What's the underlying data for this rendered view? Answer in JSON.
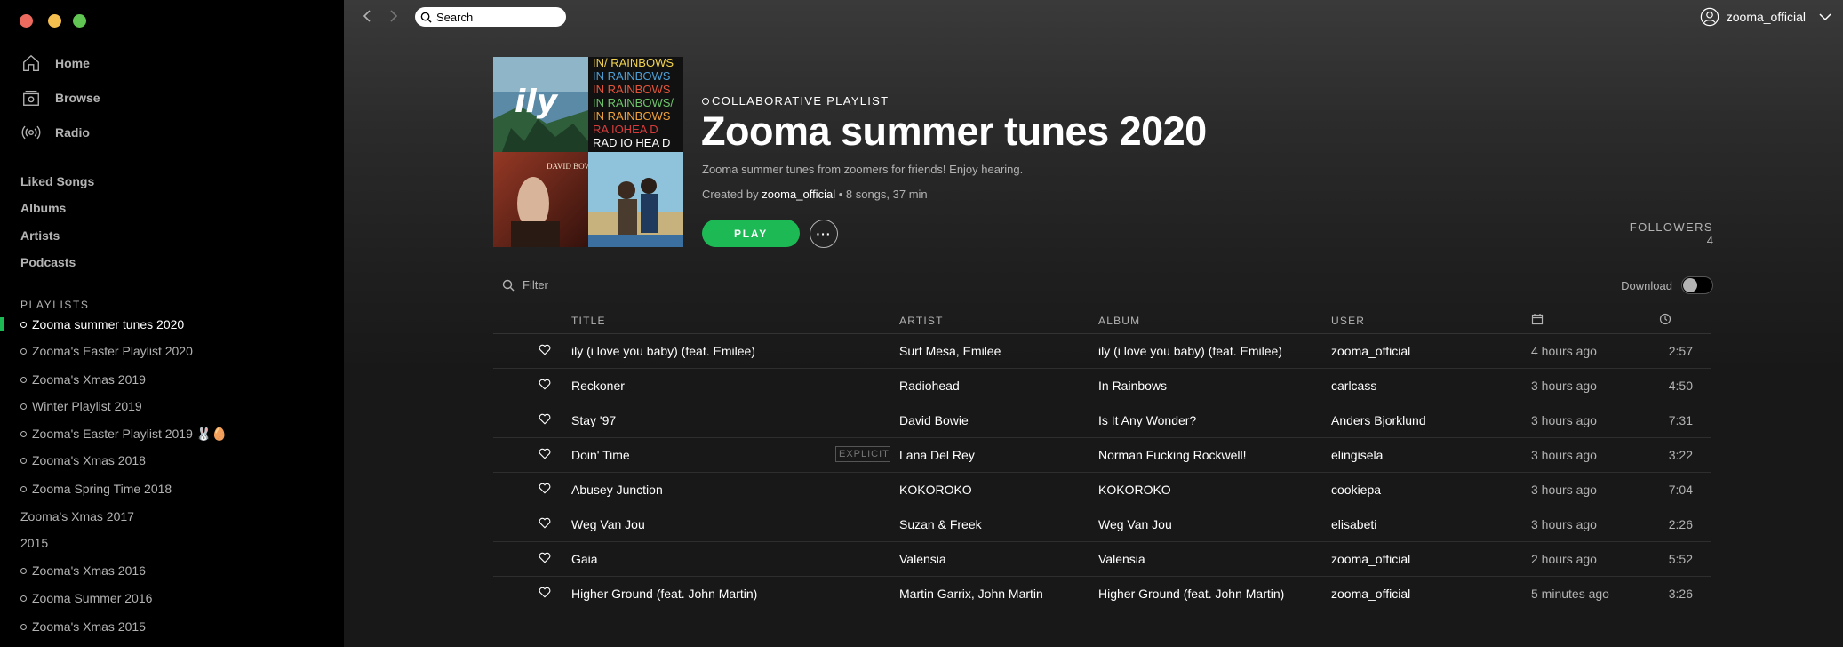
{
  "window": {
    "traffic_lights": [
      "#ed6a5e",
      "#f5bf4f",
      "#61c554"
    ]
  },
  "sidebar": {
    "nav": [
      {
        "label": "Home",
        "icon": "home-icon"
      },
      {
        "label": "Browse",
        "icon": "browse-icon"
      },
      {
        "label": "Radio",
        "icon": "radio-icon"
      }
    ],
    "library": [
      "Liked Songs",
      "Albums",
      "Artists",
      "Podcasts"
    ],
    "playlists_header": "PLAYLISTS",
    "playlists": [
      {
        "label": "Zooma summer tunes 2020",
        "collaborative": true,
        "active": true
      },
      {
        "label": "Zooma's Easter Playlist 2020",
        "collaborative": true
      },
      {
        "label": "Zooma's Xmas 2019",
        "collaborative": true
      },
      {
        "label": "Winter Playlist 2019",
        "collaborative": true
      },
      {
        "label": "Zooma's Easter Playlist 2019 🐰🥚",
        "collaborative": true
      },
      {
        "label": "Zooma's Xmas 2018",
        "collaborative": true
      },
      {
        "label": "Zooma Spring Time 2018",
        "collaborative": true
      },
      {
        "label": "Zooma's Xmas 2017",
        "collaborative": false
      },
      {
        "label": "2015",
        "collaborative": false
      },
      {
        "label": "Zooma's Xmas 2016",
        "collaborative": true
      },
      {
        "label": "Zooma Summer 2016",
        "collaborative": true
      },
      {
        "label": "Zooma's Xmas 2015",
        "collaborative": true
      }
    ]
  },
  "topbar": {
    "search_placeholder": "Search",
    "username": "zooma_official"
  },
  "playlist": {
    "tag": "COLLABORATIVE PLAYLIST",
    "title": "Zooma summer tunes 2020",
    "description": "Zooma summer tunes from zoomers for friends! Enjoy hearing.",
    "created_by_prefix": "Created by",
    "owner": "zooma_official",
    "stats": " • 8 songs, 37 min",
    "play_label": "PLAY",
    "more_label": "···",
    "followers_label": "FOLLOWERS",
    "followers_count": "4",
    "cover_text": {
      "ily": "ily",
      "rainbows_lines": [
        "IN/ RAINBOWS",
        "IN RAINBOWS",
        "IN RAINBOWS",
        "IN RAINBOWS/",
        "IN RAINBOWS",
        "RA IOHEA D",
        "RAD IO HEA D"
      ],
      "bowie": "DAVID BOWIE"
    }
  },
  "filter": {
    "placeholder": "Filter"
  },
  "download": {
    "label": "Download",
    "enabled": false
  },
  "table": {
    "headers": {
      "title": "TITLE",
      "artist": "ARTIST",
      "album": "ALBUM",
      "user": "USER"
    },
    "explicit_label": "EXPLICIT",
    "rows": [
      {
        "title": "ily (i love you baby) (feat. Emilee)",
        "artist": "Surf Mesa, Emilee",
        "album": "ily (i love you baby) (feat. Emilee)",
        "user": "zooma_official",
        "added": "4 hours ago",
        "duration": "2:57"
      },
      {
        "title": "Reckoner",
        "artist": "Radiohead",
        "album": "In Rainbows",
        "user": "carlcass",
        "added": "3 hours ago",
        "duration": "4:50"
      },
      {
        "title": "Stay '97",
        "artist": "David Bowie",
        "album": "Is It Any Wonder?",
        "user": "Anders Bjorklund",
        "added": "3 hours ago",
        "duration": "7:31"
      },
      {
        "title": "Doin' Time",
        "artist": "Lana Del Rey",
        "album": "Norman Fucking Rockwell!",
        "user": "elingisela",
        "added": "3 hours ago",
        "duration": "3:22",
        "explicit": true
      },
      {
        "title": "Abusey Junction",
        "artist": "KOKOROKO",
        "album": "KOKOROKO",
        "user": "cookiepa",
        "added": "3 hours ago",
        "duration": "7:04"
      },
      {
        "title": "Weg Van Jou",
        "artist": "Suzan & Freek",
        "album": "Weg Van Jou",
        "user": "elisabeti",
        "added": "3 hours ago",
        "duration": "2:26"
      },
      {
        "title": "Gaia",
        "artist": "Valensia",
        "album": "Valensia",
        "user": "zooma_official",
        "added": "2 hours ago",
        "duration": "5:52"
      },
      {
        "title": "Higher Ground (feat. John Martin)",
        "artist": "Martin Garrix, John Martin",
        "album": "Higher Ground (feat. John Martin)",
        "user": "zooma_official",
        "added": "5 minutes ago",
        "duration": "3:26"
      }
    ]
  },
  "colors": {
    "accent": "#1db954",
    "sidebar_bg": "#000000",
    "main_bg": "#181818"
  }
}
